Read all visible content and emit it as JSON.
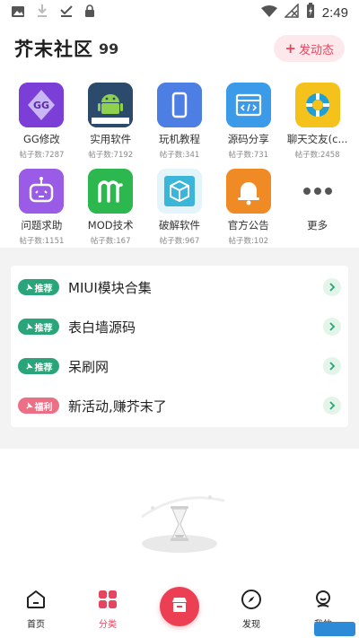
{
  "status_bar": {
    "time": "2:49",
    "left_icons": [
      "image-icon",
      "download-icon",
      "check-download-icon",
      "lock-icon"
    ],
    "right_icons": [
      "wifi-icon",
      "no-signal-icon",
      "battery-charging-icon"
    ]
  },
  "header": {
    "title": "芥末社区",
    "quote_mark": "99",
    "post_button_label": "发动态",
    "post_button_plus": "+"
  },
  "categories": [
    {
      "label": "GG修改",
      "count": "帖子数:7287",
      "icon": "gg-modifier-icon",
      "color": "#7b3fd8"
    },
    {
      "label": "实用软件",
      "count": "帖子数:7192",
      "icon": "android-icon",
      "color": "#2c4a6b"
    },
    {
      "label": "玩机教程",
      "count": "帖子数:341",
      "icon": "phone-icon",
      "color": "#4d7ee4"
    },
    {
      "label": "源码分享",
      "count": "帖子数:731",
      "icon": "code-window-icon",
      "color": "#3c9be8"
    },
    {
      "label": "聊天交友(c...",
      "count": "帖子数:2458",
      "icon": "lifebuoy-icon",
      "color": "#f5c21b"
    },
    {
      "label": "问题求助",
      "count": "帖子数:1151",
      "icon": "robot-icon",
      "color": "#9a5be6"
    },
    {
      "label": "MOD技术",
      "count": "帖子数:167",
      "icon": "mod-m-icon",
      "color": "#2cb84f"
    },
    {
      "label": "破解软件",
      "count": "帖子数:967",
      "icon": "cube-icon",
      "color": "#e4f4fb"
    },
    {
      "label": "官方公告",
      "count": "帖子数:102",
      "icon": "bell-icon",
      "color": "#f08a24"
    },
    {
      "label": "更多",
      "count": "",
      "icon": "more-dots-icon",
      "color": "#ffffff"
    }
  ],
  "recommendations": [
    {
      "tag": "推荐",
      "title": "MIUI模块合集",
      "tag_color": "#2aa57a"
    },
    {
      "tag": "推荐",
      "title": "表白墙源码",
      "tag_color": "#2aa57a"
    },
    {
      "tag": "推荐",
      "title": "呆刷网",
      "tag_color": "#2aa57a"
    },
    {
      "tag": "福利",
      "title": "新活动,赚芥末了",
      "tag_color": "#ec6f86"
    }
  ],
  "bottom_nav": {
    "home": "首页",
    "category": "分类",
    "discover": "发现",
    "mine": "我的"
  },
  "colors": {
    "accent": "#e5455e",
    "green": "#2aa57a"
  }
}
